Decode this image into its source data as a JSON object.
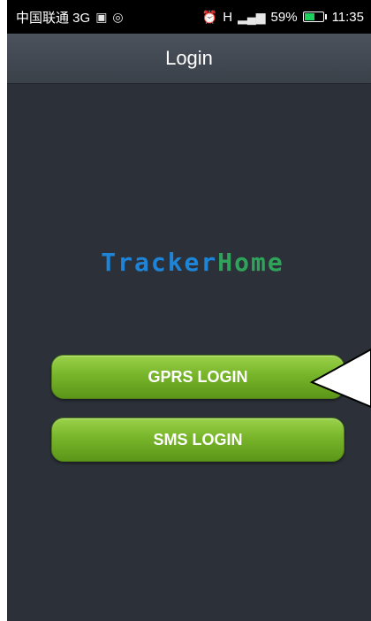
{
  "status_bar": {
    "carrier": "中国联通 3G",
    "left_icons": [
      "photo-icon",
      "notification-icon"
    ],
    "right_icons": [
      "alarm-icon",
      "data-h-icon",
      "signal-icon"
    ],
    "data_indicator": "H",
    "battery_percent": "59%",
    "time": "11:35",
    "battery_level": 0.59
  },
  "header": {
    "title": "Login"
  },
  "logo": {
    "part1": "Tracker",
    "part2": "Home",
    "color1": "#1e84d8",
    "color2": "#2fa35a"
  },
  "buttons": {
    "gprs_label": "GPRS LOGIN",
    "sms_label": "SMS LOGIN",
    "color": "#78b52a"
  }
}
